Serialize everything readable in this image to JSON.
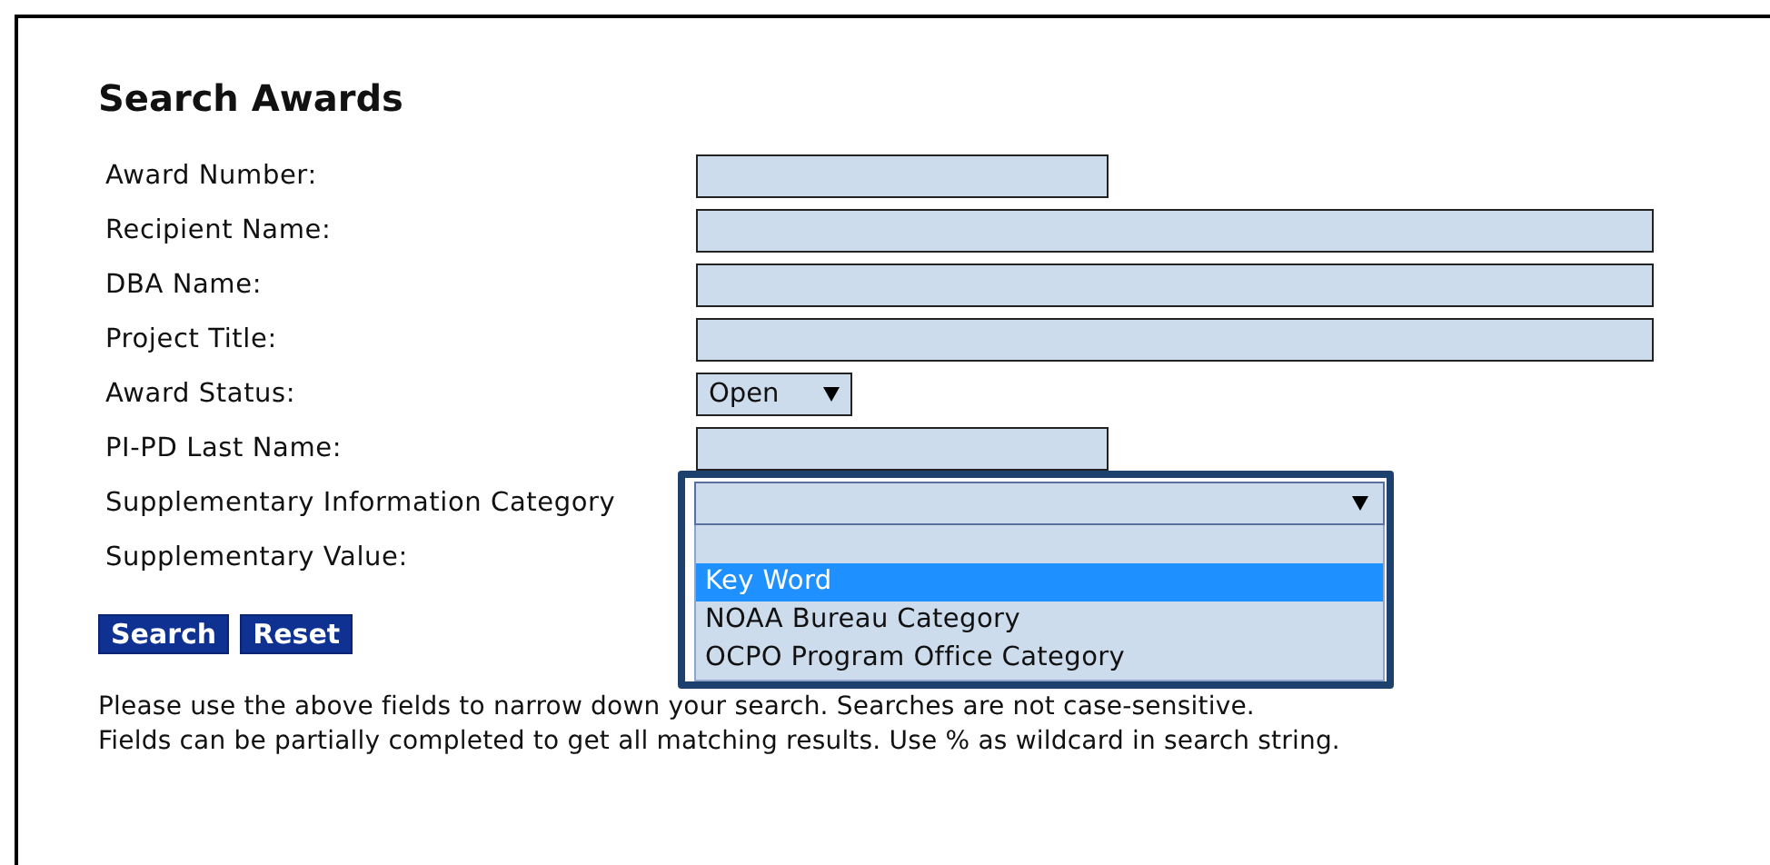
{
  "title": "Search Awards",
  "fields": [
    {
      "label": "Award Number:",
      "kind": "short-text"
    },
    {
      "label": "Recipient Name:",
      "kind": "long-text"
    },
    {
      "label": "DBA Name:",
      "kind": "long-text"
    },
    {
      "label": "Project Title:",
      "kind": "long-text"
    },
    {
      "label": "Award Status:",
      "kind": "select",
      "value": "Open"
    },
    {
      "label": "PI-PD Last Name:",
      "kind": "short-text"
    },
    {
      "label": "Supplementary Information Category",
      "kind": "open-select",
      "options": [
        {
          "label": "Key Word",
          "selected": true
        },
        {
          "label": "NOAA Bureau Category",
          "selected": false
        },
        {
          "label": "OCPO Program Office Category",
          "selected": false
        }
      ]
    },
    {
      "label": "Supplementary Value:",
      "kind": "hidden"
    }
  ],
  "buttons": [
    "Search",
    "Reset"
  ],
  "help": [
    "Please use the above fields to narrow down your search. Searches are not case-sensitive.",
    "Fields can be partially completed to get all matching results. Use % as wildcard in search string."
  ]
}
